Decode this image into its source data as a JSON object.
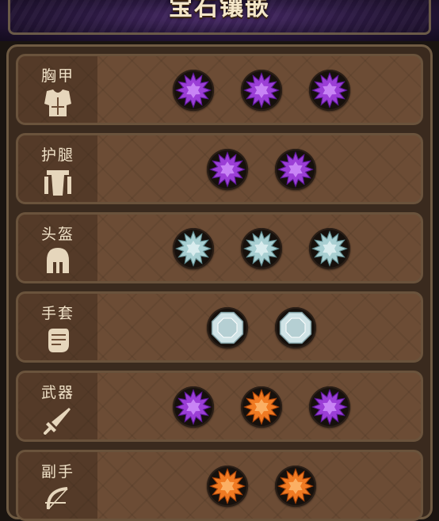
{
  "header": {
    "title": "宝石镶嵌"
  },
  "colors": {
    "purple": "#9b3ed6",
    "orange": "#f07a22",
    "teal": "#a8cfd2",
    "silver": "#cfe3e6"
  },
  "rows": [
    {
      "label": "胸甲",
      "icon": "chest-armor-icon",
      "gems": [
        "purple-star",
        "purple-star",
        "purple-star"
      ]
    },
    {
      "label": "护腿",
      "icon": "leg-armor-icon",
      "gems": [
        "purple-star",
        "purple-star"
      ]
    },
    {
      "label": "头盔",
      "icon": "helmet-icon",
      "gems": [
        "teal-star",
        "teal-star",
        "teal-star"
      ]
    },
    {
      "label": "手套",
      "icon": "glove-icon",
      "gems": [
        "silver-octagon",
        "silver-octagon"
      ]
    },
    {
      "label": "武器",
      "icon": "sword-icon",
      "gems": [
        "purple-star",
        "orange-star",
        "purple-star"
      ]
    },
    {
      "label": "副手",
      "icon": "bow-icon",
      "gems": [
        "orange-star",
        "orange-star"
      ]
    }
  ]
}
